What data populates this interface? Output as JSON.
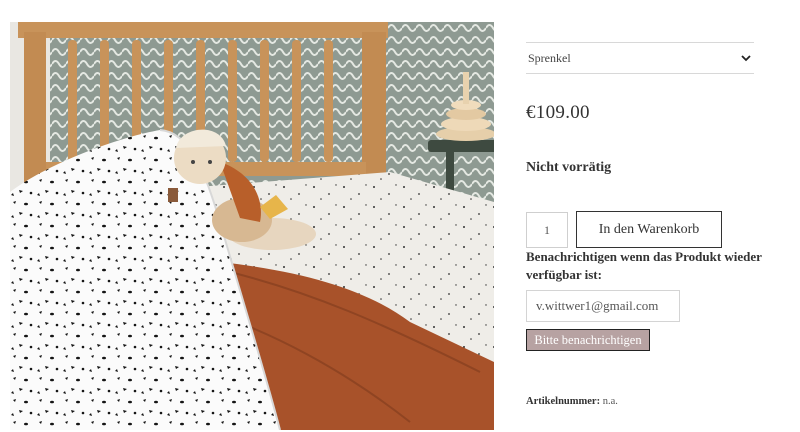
{
  "product": {
    "image_alt": "Bett mit Decke, Puppe und Musselintuch",
    "variant": {
      "selected": "Sprenkel",
      "icon": "chevron-down-icon"
    },
    "price": "€109.00",
    "stock_status": "Nicht vorrätig",
    "quantity": "1",
    "add_to_cart_label": "In den Warenkorb",
    "notify": {
      "label": "Benachrichtigen wenn das Produkt wieder verfügbar ist:",
      "email_value": "v.wittwer1@gmail.com",
      "button_label": "Bitte benachrichtigen",
      "button_color": "#b7a2a2"
    },
    "sku_label": "Artikelnummer:",
    "sku_value": "n.a."
  },
  "colors": {
    "wallpaper": "#8e9a92",
    "bed_frame": "#c8935a",
    "blanket": "#ffffff",
    "muslin": "#a8522a",
    "sheet": "#f1efea"
  }
}
